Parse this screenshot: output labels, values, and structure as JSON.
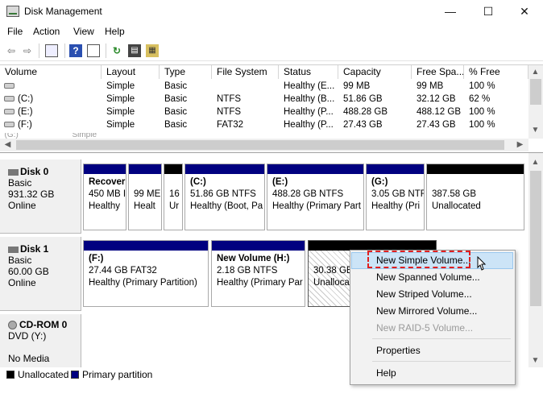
{
  "window": {
    "title": "Disk Management",
    "minimize": "—",
    "maximize": "☐",
    "close": "✕"
  },
  "menubar": [
    "File",
    "Action",
    "View",
    "Help"
  ],
  "toolbar_icons": [
    "back-arrow-icon",
    "forward-arrow-icon",
    "console-tree-icon",
    "help-icon",
    "properties-icon",
    "refresh-icon",
    "disk-properties-icon",
    "settings-icon"
  ],
  "volume_table": {
    "columns": [
      "Volume",
      "Layout",
      "Type",
      "File System",
      "Status",
      "Capacity",
      "Free Spa...",
      "% Free"
    ],
    "rows": [
      [
        "",
        "Simple",
        "Basic",
        "",
        "Healthy (E...",
        "99 MB",
        "99 MB",
        "100 %"
      ],
      [
        "(C:)",
        "Simple",
        "Basic",
        "NTFS",
        "Healthy (B...",
        "51.86 GB",
        "32.12 GB",
        "62 %"
      ],
      [
        "(E:)",
        "Simple",
        "Basic",
        "NTFS",
        "Healthy (P...",
        "488.28 GB",
        "488.12 GB",
        "100 %"
      ],
      [
        "(F:)",
        "Simple",
        "Basic",
        "FAT32",
        "Healthy (P...",
        "27.43 GB",
        "27.43 GB",
        "100 %"
      ]
    ]
  },
  "disks": [
    {
      "name": "Disk 0",
      "type": "Basic",
      "size": "931.32 GB",
      "status": "Online",
      "partitions": [
        {
          "line1": "Recover",
          "line2": "450 MB I",
          "line3": "Healthy"
        },
        {
          "line1": "",
          "line2": "99 ME",
          "line3": "Healt"
        },
        {
          "line1": "",
          "line2": "16",
          "line3": "Ur"
        },
        {
          "line1": "(C:)",
          "line2": "51.86 GB NTFS",
          "line3": "Healthy (Boot, Pa"
        },
        {
          "line1": "(E:)",
          "line2": "488.28 GB NTFS",
          "line3": "Healthy (Primary Part"
        },
        {
          "line1": "(G:)",
          "line2": "3.05 GB NTF",
          "line3": "Healthy (Pri"
        },
        {
          "line1": "",
          "line2": "387.58 GB",
          "line3": "Unallocated"
        }
      ]
    },
    {
      "name": "Disk 1",
      "type": "Basic",
      "size": "60.00 GB",
      "status": "Online",
      "partitions": [
        {
          "line1": "(F:)",
          "line2": "27.44 GB FAT32",
          "line3": "Healthy (Primary Partition)"
        },
        {
          "line1": "New Volume  (H:)",
          "line2": "2.18 GB NTFS",
          "line3": "Healthy (Primary Par"
        },
        {
          "line1": "",
          "line2": "30.38 GB",
          "line3": "Unalloca"
        }
      ]
    },
    {
      "name": "CD-ROM 0",
      "type": "DVD (Y:)",
      "size": "",
      "status": "No Media"
    }
  ],
  "legend": {
    "unallocated": "Unallocated",
    "primary": "Primary partition"
  },
  "context_menu": {
    "items": [
      "New Simple Volume...",
      "New Spanned Volume...",
      "New Striped Volume...",
      "New Mirrored Volume...",
      "New RAID-5 Volume...",
      "Properties",
      "Help"
    ],
    "highlighted": "New Simple Volume...",
    "disabled": [
      "New RAID-5 Volume..."
    ]
  },
  "colors": {
    "primary_partition": "#000080",
    "unallocated": "#000000",
    "highlight": "#cce4f7",
    "callout_border": "#e02020"
  }
}
